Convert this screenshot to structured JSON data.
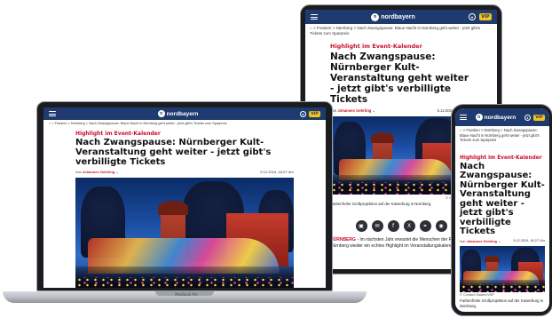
{
  "site": {
    "brand": "nordbayern",
    "brand_mark": "n",
    "vip": "VIP",
    "user_icon": "user-icon",
    "colors": {
      "header": "#1f3a6e",
      "accent": "#c8102e",
      "vip": "#f4c21a"
    }
  },
  "breadcrumb": {
    "home_icon": "home-icon",
    "items": [
      "Franken",
      "Nürnberg",
      "Nach Zwangspause: Blaue Nacht in Nürnberg geht weiter - jetzt gibt's Tickets zum Sparpreis"
    ],
    "items_short": [
      "Franken",
      "Nürnberg",
      "Nach Zwangspause: Blaue Nacht in Nürnberg geht weiter - jetzt gibt's Tickets zum Sparpreis"
    ]
  },
  "article": {
    "kicker": "Highlight im Event-Kalender",
    "headline": "Nach Zwangspause: Nürnberger Kult-Veranstaltung geht weiter - jetzt gibt's verbilligte Tickets",
    "byline_prefix": "Von",
    "author": "Johannes Gehrling",
    "date": "5.12.2024, 18:27 Uhr",
    "date_short": "5.12.2024, 18:27 Uhr",
    "photo_credit": "© Contact",
    "photo_credit_phone": "© Contact Gladev/VNP",
    "caption": "Farbenfrohe Großprojektion auf der Kaiserburg in Nürnberg.",
    "caption_phone": "Farbenfrohe Großprojektion auf der Kaiserburg in Nürnberg.",
    "teaser_lead": "NÜRNBERG",
    "teaser": " - Im nächsten Jahr erwartet die Menschen der Region Nürnberg wieder ein echtes Highlight im Veranstaltungskalender."
  },
  "share": [
    "comment-icon",
    "mail-icon",
    "facebook-icon",
    "x-icon",
    "link-icon",
    "whatsapp-icon"
  ],
  "share_glyphs": [
    "▣",
    "✉",
    "f",
    "X",
    "⚭",
    "◉"
  ],
  "laptop": {
    "label": "MacBook Pro"
  }
}
